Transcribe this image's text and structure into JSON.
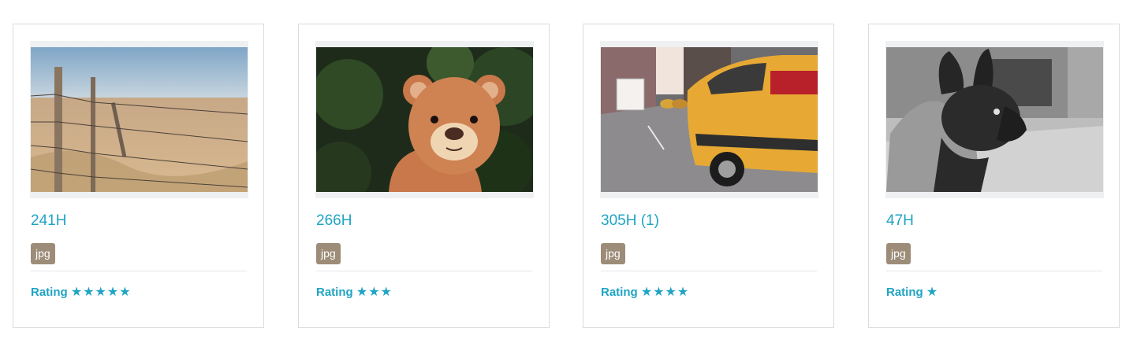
{
  "rating_label": "Rating",
  "colors": {
    "accent": "#1fa4c4",
    "badge": "#9c8c78",
    "border": "#dcdcdc"
  },
  "cards": [
    {
      "title": "241H",
      "file_type": "jpg",
      "stars": "★★★★★",
      "rating": 5,
      "image": "fence-field-photo"
    },
    {
      "title": "266H",
      "file_type": "jpg",
      "stars": "★★★",
      "rating": 3,
      "image": "teddy-bear-photo"
    },
    {
      "title": "305H (1)",
      "file_type": "jpg",
      "stars": "★★★★",
      "rating": 4,
      "image": "yellow-taxi-photo"
    },
    {
      "title": "47H",
      "file_type": "jpg",
      "stars": "★",
      "rating": 1,
      "image": "french-bulldog-photo"
    }
  ]
}
